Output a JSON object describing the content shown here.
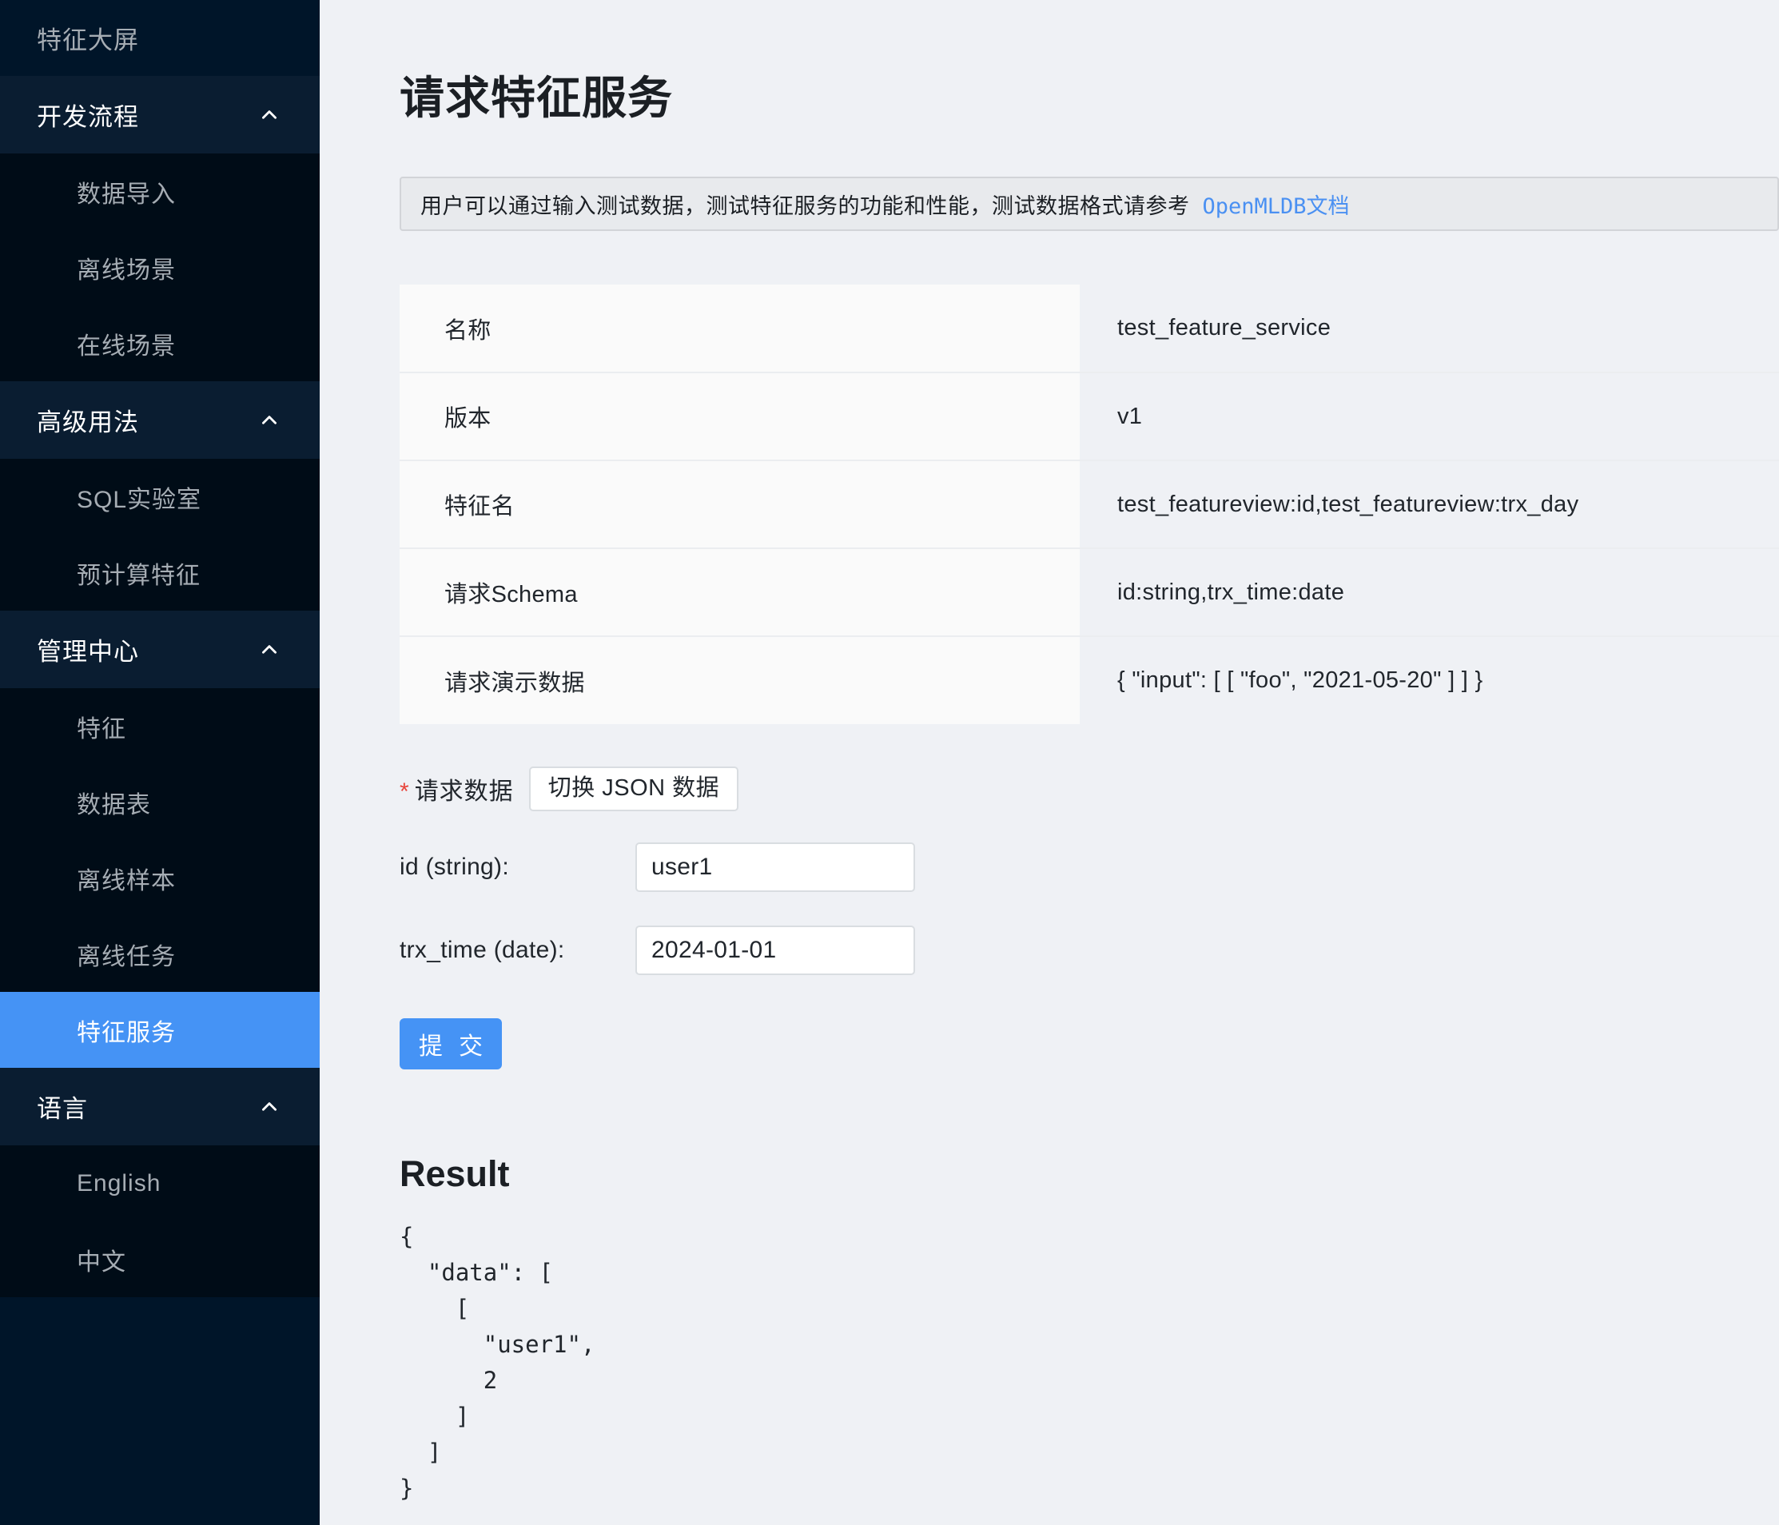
{
  "sidebar": {
    "dashboard_item": {
      "label": "特征大屏"
    },
    "groups": [
      {
        "title": "开发流程",
        "caret": "chevron-up-icon",
        "items": [
          {
            "label": "数据导入",
            "selected": false
          },
          {
            "label": "离线场景",
            "selected": false
          },
          {
            "label": "在线场景",
            "selected": false
          }
        ]
      },
      {
        "title": "高级用法",
        "caret": "chevron-up-icon",
        "items": [
          {
            "label": "SQL实验室",
            "selected": false
          },
          {
            "label": "预计算特征",
            "selected": false
          }
        ]
      },
      {
        "title": "管理中心",
        "caret": "chevron-up-icon",
        "items": [
          {
            "label": "特征",
            "selected": false
          },
          {
            "label": "数据表",
            "selected": false
          },
          {
            "label": "离线样本",
            "selected": false
          },
          {
            "label": "离线任务",
            "selected": false
          },
          {
            "label": "特征服务",
            "selected": true
          }
        ]
      },
      {
        "title": "语言",
        "caret": "chevron-up-icon",
        "items": [
          {
            "label": "English",
            "selected": false
          },
          {
            "label": "中文",
            "selected": false
          }
        ]
      }
    ],
    "colors": {
      "background": "#001529",
      "group_header_background": "#0a1d31",
      "submenu_background": "#000c17",
      "selected_background": "#4593f5",
      "text": "#a6adb4",
      "active_text": "#ffffff"
    }
  },
  "main": {
    "page_title": "请求特征服务",
    "alert": {
      "text": "用户可以通过输入测试数据，测试特征服务的功能和性能，测试数据格式请参考",
      "link_text": "OpenMLDB文档",
      "link_color": "#4a90f2"
    },
    "info_table": {
      "rows": [
        {
          "label": "名称",
          "value": "test_feature_service"
        },
        {
          "label": "版本",
          "value": "v1"
        },
        {
          "label": "特征名",
          "value": "test_featureview:id,test_featureview:trx_day"
        },
        {
          "label": "请求Schema",
          "value": "id:string,trx_time:date"
        },
        {
          "label": "请求演示数据",
          "value": "{ \"input\": [ [ \"foo\", \"2021-05-20\" ] ] }"
        }
      ]
    },
    "form": {
      "required_mark": "*",
      "request_data_label": "请求数据",
      "toggle_json_label": "切换 JSON 数据",
      "fields": [
        {
          "label": "id (string):",
          "value": "user1",
          "placeholder": ""
        },
        {
          "label": "trx_time (date):",
          "value": "2024-01-01",
          "placeholder": ""
        }
      ],
      "submit_label": "提 交",
      "submit_color": "#4593f5"
    },
    "result": {
      "title": "Result",
      "json": "{\n  \"data\": [\n    [\n      \"user1\",\n      2\n    ]\n  ]\n}"
    }
  }
}
